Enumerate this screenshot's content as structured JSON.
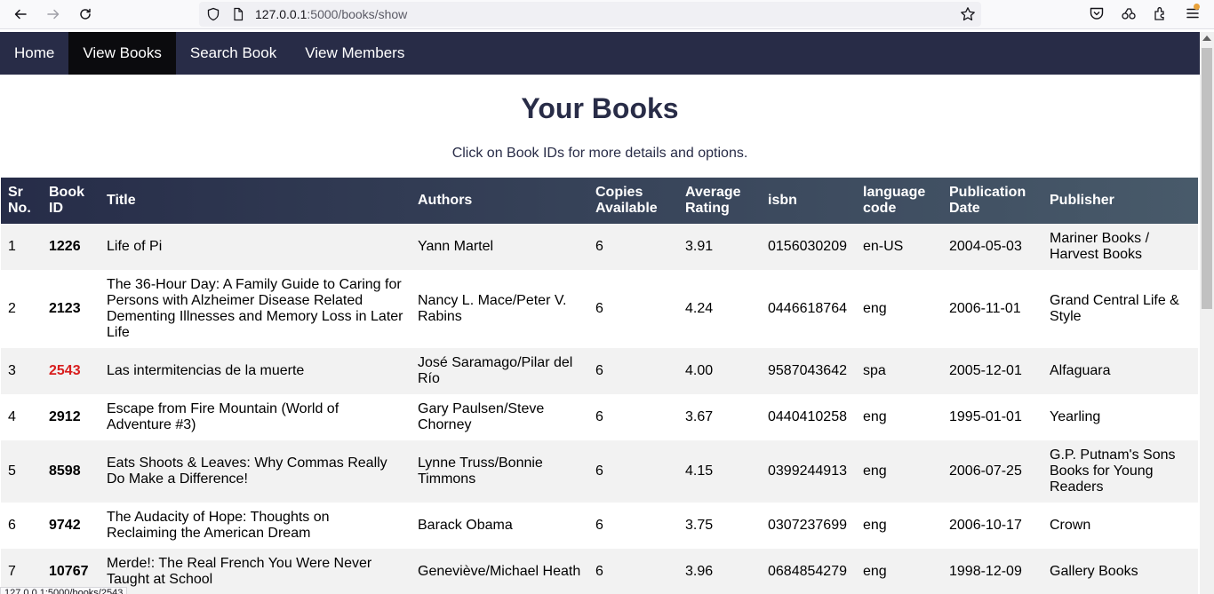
{
  "browser": {
    "url_host": "127.0.0.1",
    "url_path": ":5000/books/show"
  },
  "nav": {
    "items": [
      {
        "label": "Home"
      },
      {
        "label": "View Books"
      },
      {
        "label": "Search Book"
      },
      {
        "label": "View Members"
      }
    ],
    "active_index": 1
  },
  "page": {
    "title": "Your Books",
    "subtitle": "Click on Book IDs for more details and options."
  },
  "table": {
    "headers": [
      "Sr No.",
      "Book ID",
      "Title",
      "Authors",
      "Copies Available",
      "Average Rating",
      "isbn",
      "language code",
      "Publication Date",
      "Publisher"
    ],
    "rows": [
      [
        "1",
        "1226",
        "Life of Pi",
        "Yann Martel",
        "6",
        "3.91",
        "0156030209",
        "en-US",
        "2004-05-03",
        "Mariner Books / Harvest Books"
      ],
      [
        "2",
        "2123",
        "The 36-Hour Day: A Family Guide to Caring for Persons with Alzheimer Disease Related Dementing Illnesses and Memory Loss in Later Life",
        "Nancy L. Mace/Peter V. Rabins",
        "6",
        "4.24",
        "0446618764",
        "eng",
        "2006-11-01",
        "Grand Central Life & Style"
      ],
      [
        "3",
        "2543",
        "Las intermitencias de la muerte",
        "José Saramago/Pilar del Río",
        "6",
        "4.00",
        "9587043642",
        "spa",
        "2005-12-01",
        "Alfaguara"
      ],
      [
        "4",
        "2912",
        "Escape from Fire Mountain (World of Adventure #3)",
        "Gary Paulsen/Steve Chorney",
        "6",
        "3.67",
        "0440410258",
        "eng",
        "1995-01-01",
        "Yearling"
      ],
      [
        "5",
        "8598",
        "Eats Shoots & Leaves: Why Commas Really Do Make a Difference!",
        "Lynne Truss/Bonnie Timmons",
        "6",
        "4.15",
        "0399244913",
        "eng",
        "2006-07-25",
        "G.P. Putnam's Sons Books for Young Readers"
      ],
      [
        "6",
        "9742",
        "The Audacity of Hope: Thoughts on Reclaiming the American Dream",
        "Barack Obama",
        "6",
        "3.75",
        "0307237699",
        "eng",
        "2006-10-17",
        "Crown"
      ],
      [
        "7",
        "10767",
        "Merde!: The Real French You Were Never Taught at School",
        "Geneviève/Michael Heath",
        "6",
        "3.96",
        "0684854279",
        "eng",
        "1998-12-09",
        "Gallery Books"
      ]
    ],
    "hover_row_index": 2
  },
  "status_bar": {
    "url": "127.0.0.1:5000/books/2543"
  },
  "colors": {
    "nav_bg": "#282c47",
    "nav_active": "#0b0b0e",
    "title": "#282c47",
    "header_gradient_start": "#262c48",
    "header_gradient_end": "#485a6a",
    "row_odd": "#f2f2f2",
    "link_hover": "#d81e1e"
  },
  "icons": [
    "back-icon",
    "forward-icon",
    "reload-icon",
    "shield-icon",
    "page-icon",
    "bookmark-star-icon",
    "pocket-icon",
    "account-icon",
    "extensions-icon",
    "menu-icon"
  ]
}
